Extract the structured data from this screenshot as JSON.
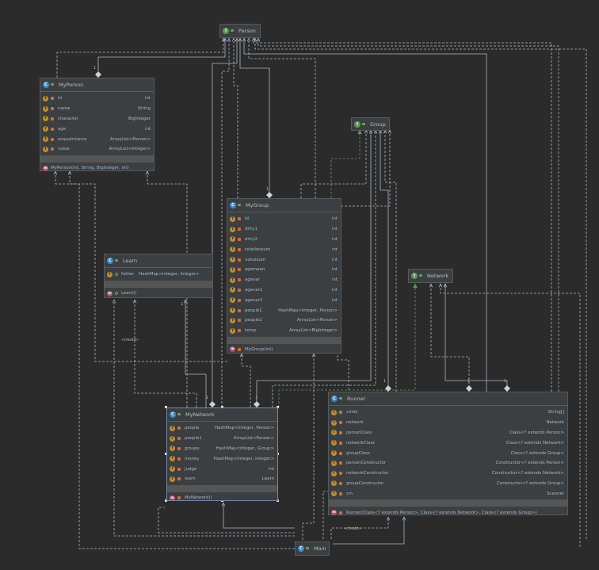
{
  "classes": {
    "person": {
      "name": "Person",
      "kind": "I"
    },
    "group": {
      "name": "Group",
      "kind": "I"
    },
    "network": {
      "name": "Network",
      "kind": "I"
    },
    "main": {
      "name": "Main",
      "kind": "C"
    },
    "myperson": {
      "name": "MyPerson",
      "kind": "C",
      "fields": [
        {
          "name": "id",
          "type": "int"
        },
        {
          "name": "name",
          "type": "String"
        },
        {
          "name": "character",
          "type": "BigInteger"
        },
        {
          "name": "age",
          "type": "int"
        },
        {
          "name": "acquaintance",
          "type": "ArrayList<Person>"
        },
        {
          "name": "value",
          "type": "ArrayList<Integer>"
        }
      ],
      "methods": [
        {
          "name": "MyPerson(int, String, BigInteger, int)"
        }
      ]
    },
    "learn": {
      "name": "Learn",
      "kind": "C",
      "fields": [
        {
          "name": "father",
          "type": "HashMap<Integer, Integer>"
        }
      ],
      "methods": [
        {
          "name": "Learn()"
        }
      ]
    },
    "mygroup": {
      "name": "MyGroup",
      "kind": "C",
      "fields": [
        {
          "name": "id",
          "type": "int"
        },
        {
          "name": "dirty1",
          "type": "int"
        },
        {
          "name": "dirty2",
          "type": "int"
        },
        {
          "name": "relationsum",
          "type": "int"
        },
        {
          "name": "valuesum",
          "type": "int"
        },
        {
          "name": "agemean",
          "type": "int"
        },
        {
          "name": "agevar",
          "type": "int"
        },
        {
          "name": "agevar1",
          "type": "int"
        },
        {
          "name": "agevar2",
          "type": "int"
        },
        {
          "name": "people1",
          "type": "HashMap<Integer, Person>"
        },
        {
          "name": "people2",
          "type": "ArrayList<Person>"
        },
        {
          "name": "temp",
          "type": "ArrayList<BigInteger>"
        }
      ],
      "methods": [
        {
          "name": "MyGroup(int)"
        }
      ]
    },
    "mynetwork": {
      "name": "MyNetwork",
      "kind": "C",
      "fields": [
        {
          "name": "people",
          "type": "HashMap<Integer, Person>"
        },
        {
          "name": "people1",
          "type": "ArrayList<Person>"
        },
        {
          "name": "groups",
          "type": "HashMap<Integer, Group>"
        },
        {
          "name": "money",
          "type": "HashMap<Integer, Integer>"
        },
        {
          "name": "judge",
          "type": "int"
        },
        {
          "name": "learn",
          "type": "Learn"
        }
      ],
      "methods": [
        {
          "name": "MyNetwork()"
        }
      ]
    },
    "runner": {
      "name": "Runner",
      "kind": "C",
      "fields": [
        {
          "name": "cmds",
          "type": "String[]"
        },
        {
          "name": "network",
          "type": "Network"
        },
        {
          "name": "personClass",
          "type": "Class<? extends Person>"
        },
        {
          "name": "networkClass",
          "type": "Class<? extends Network>"
        },
        {
          "name": "groupClass",
          "type": "Class<? extends Group>"
        },
        {
          "name": "personConstructor",
          "type": "Constructor<? extends Person>"
        },
        {
          "name": "networkConstructor",
          "type": "Constructor<? extends Network>"
        },
        {
          "name": "groupConstructor",
          "type": "Constructor<? extends Group>"
        },
        {
          "name": "cin",
          "type": "Scanner"
        }
      ],
      "methods": [
        {
          "name": "Runner(Class<? extends Person>, Class<? extends Network>, Class<? extends Group>)"
        }
      ]
    }
  },
  "labels": {
    "create1": "«create»",
    "create2": "«create»",
    "one": "1"
  },
  "colors": {
    "background": "#2b2b2b",
    "node": "#3c3f41",
    "line": "#a9b7c6",
    "realization": "#629755"
  }
}
